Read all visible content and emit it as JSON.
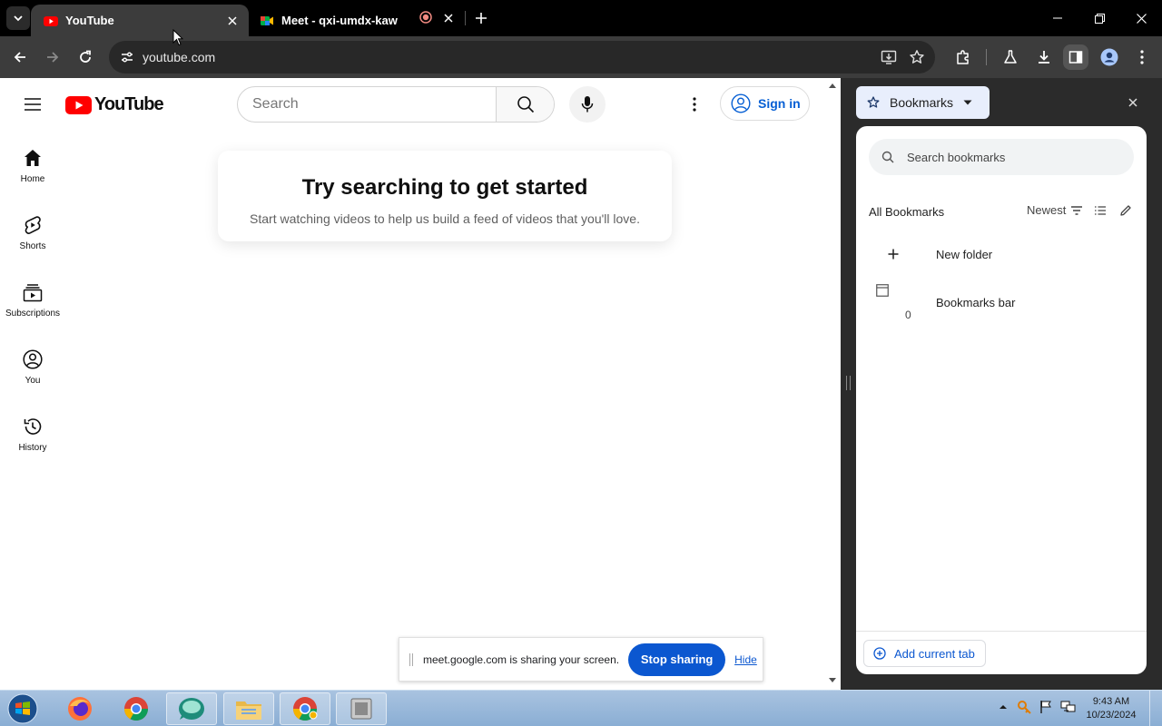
{
  "browser": {
    "tabs": [
      {
        "title": "YouTube",
        "active": true
      },
      {
        "title": "Meet - qxi-umdx-kaw",
        "active": false
      }
    ],
    "url": "youtube.com"
  },
  "youtube": {
    "logo_text": "YouTube",
    "search_placeholder": "Search",
    "sign_in": "Sign in",
    "nav": [
      {
        "label": "Home",
        "icon": "home-icon"
      },
      {
        "label": "Shorts",
        "icon": "shorts-icon"
      },
      {
        "label": "Subscriptions",
        "icon": "subscriptions-icon"
      },
      {
        "label": "You",
        "icon": "you-icon"
      },
      {
        "label": "History",
        "icon": "history-icon"
      }
    ],
    "prompt_title": "Try searching to get started",
    "prompt_sub": "Start watching videos to help us build a feed of videos that you'll love."
  },
  "share_bar": {
    "message": "meet.google.com is sharing your screen.",
    "stop_label": "Stop sharing",
    "hide_label": "Hide"
  },
  "bookmarks_panel": {
    "title": "Bookmarks",
    "search_placeholder": "Search bookmarks",
    "heading": "All Bookmarks",
    "sort_label": "Newest",
    "items": [
      {
        "label": "New folder",
        "icon": "plus-icon"
      },
      {
        "label": "Bookmarks bar",
        "icon": "folder-icon",
        "count": "0"
      }
    ],
    "add_current_tab": "Add current tab"
  },
  "taskbar": {
    "time": "9:43 AM",
    "date": "10/23/2024"
  },
  "colors": {
    "yt_red": "#ff0000",
    "link_blue": "#065fd4",
    "meet_blue": "#0b57d0"
  }
}
